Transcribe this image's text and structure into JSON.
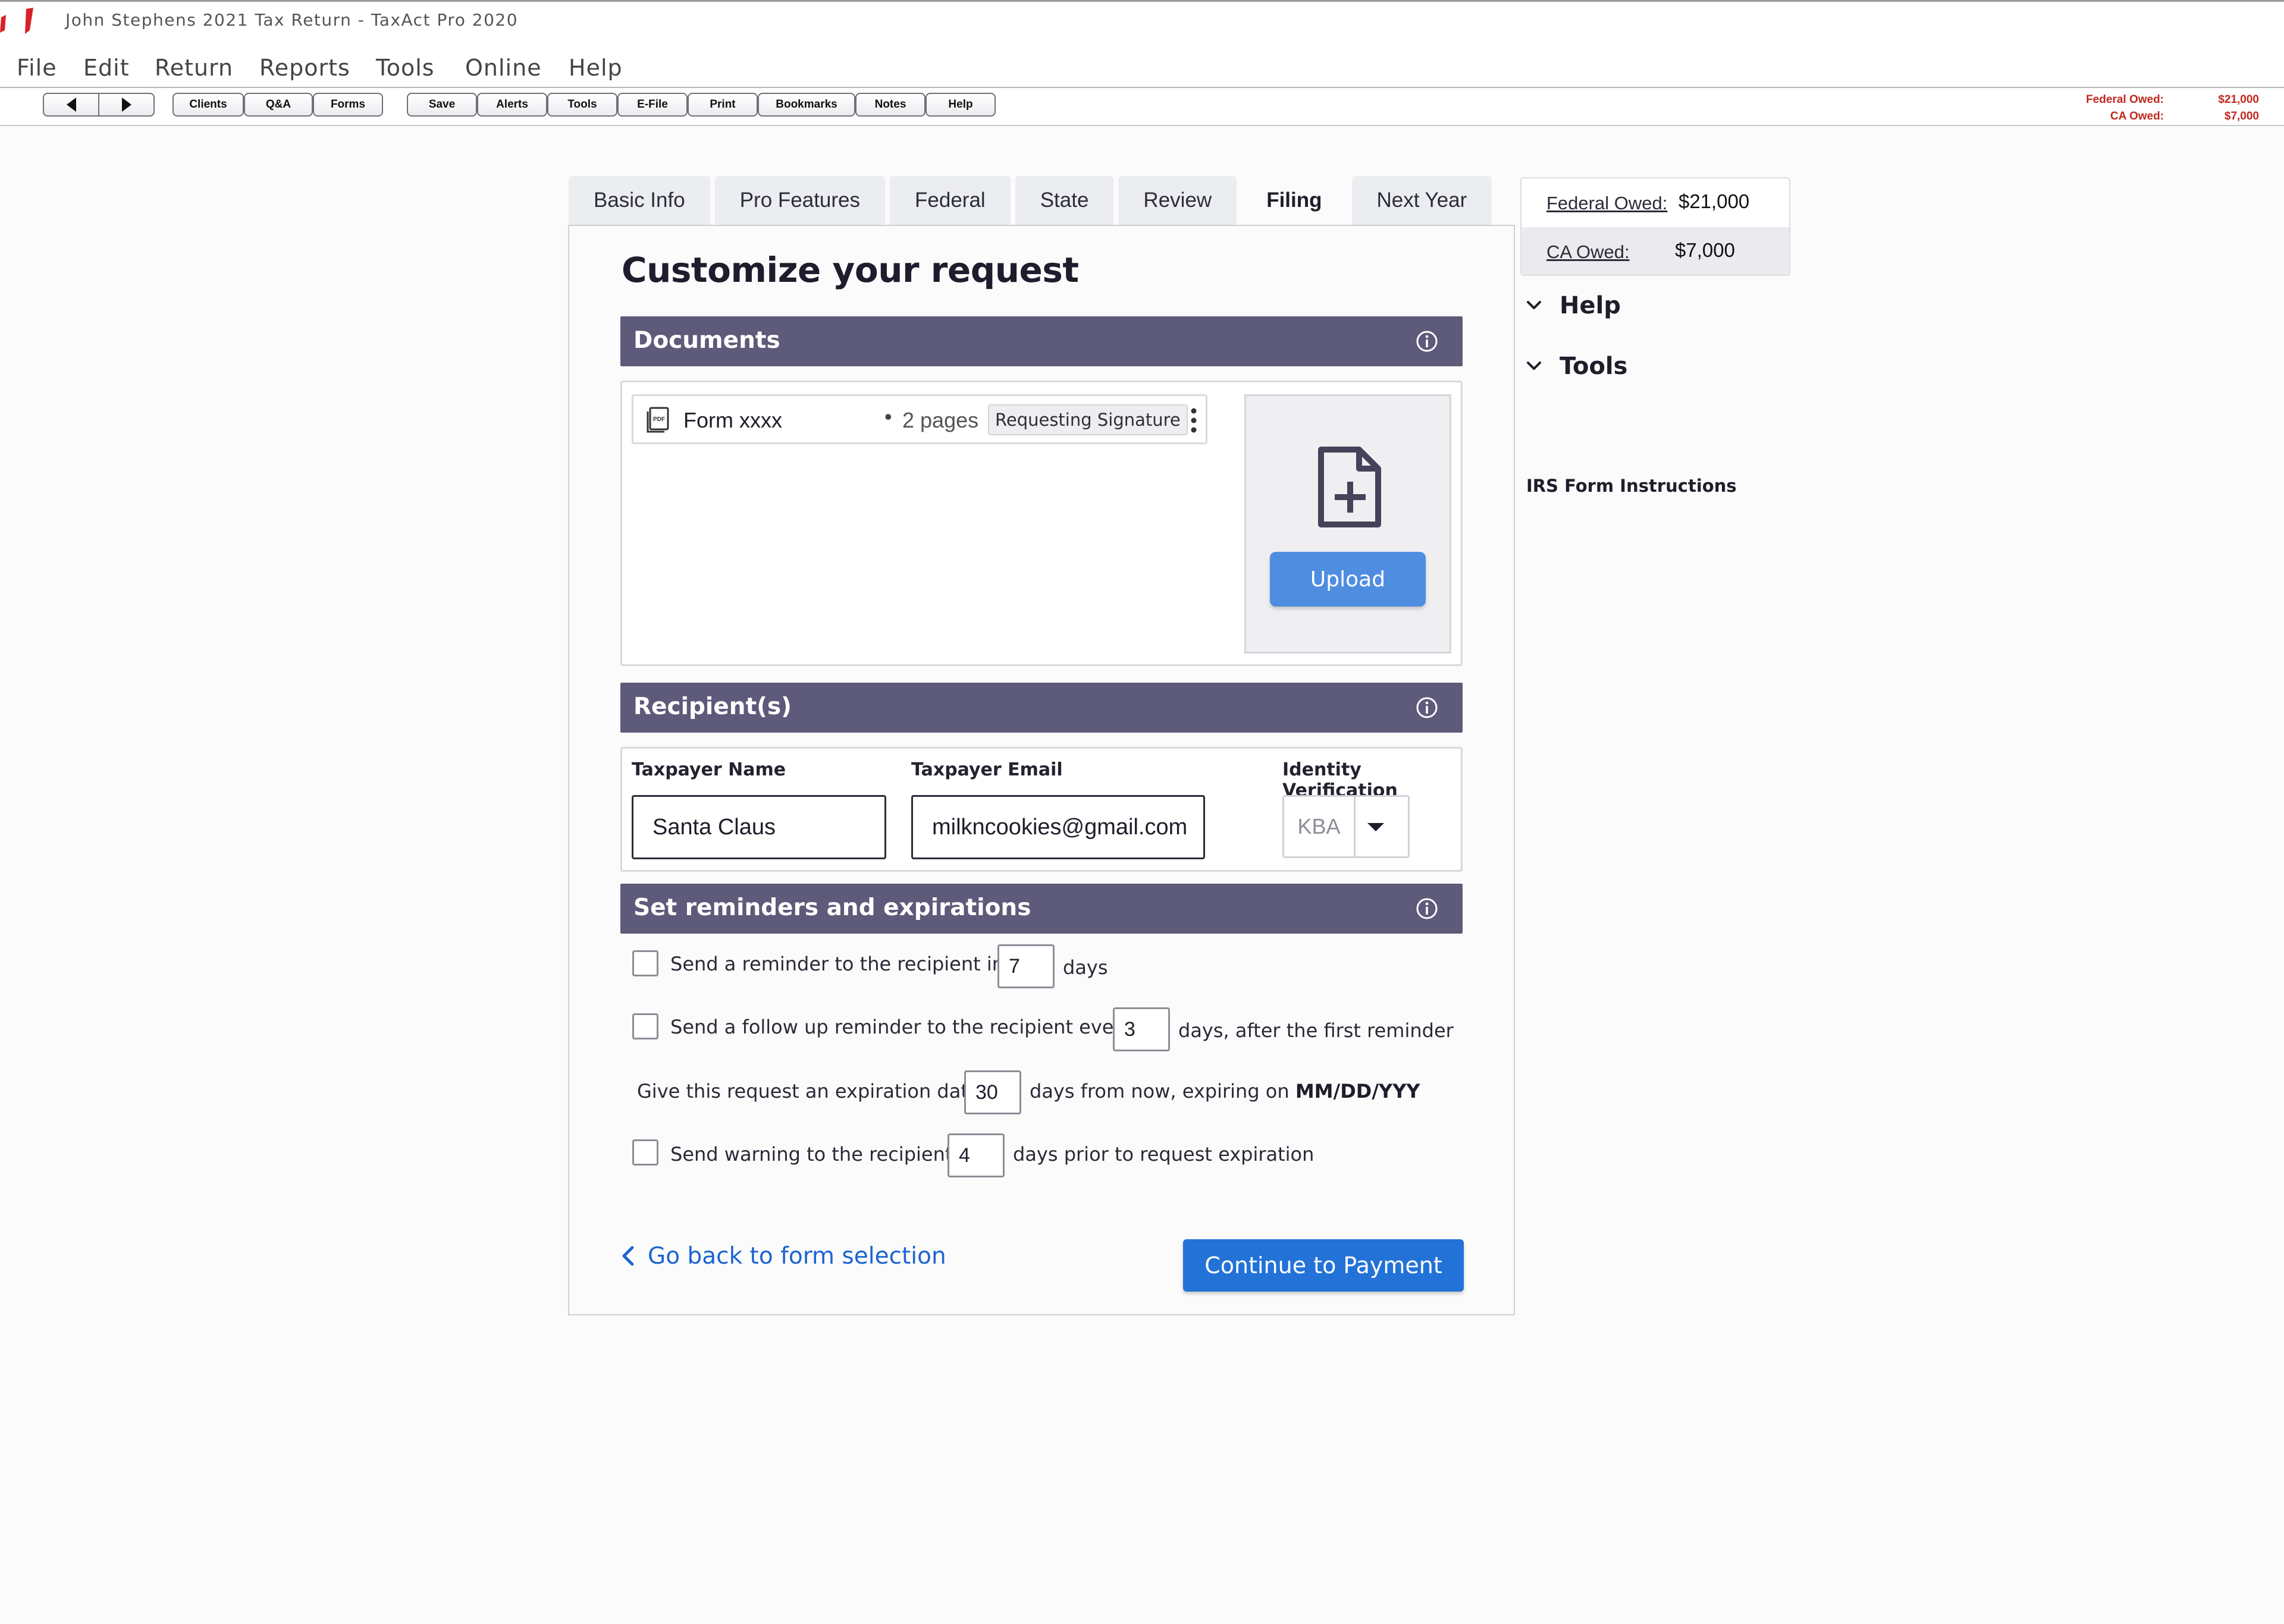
{
  "window": {
    "title": "John Stephens 2021 Tax Return - TaxAct Pro 2020"
  },
  "menu": [
    "File",
    "Edit",
    "Return",
    "Reports",
    "Tools",
    "Online",
    "Help"
  ],
  "toolbar": {
    "group1": [
      "Clients",
      "Q&A",
      "Forms"
    ],
    "group2": [
      "Save",
      "Alerts",
      "Tools",
      "E-File",
      "Print",
      "Bookmarks",
      "Notes",
      "Help"
    ],
    "federal_owed_label": "Federal Owed:",
    "federal_owed_value": "$21,000",
    "ca_owed_label": "CA Owed:",
    "ca_owed_value": "$7,000",
    "owed_color": "#c0281e"
  },
  "tabs": [
    {
      "label": "Basic Info",
      "active": false
    },
    {
      "label": "Pro Features",
      "active": false
    },
    {
      "label": "Federal",
      "active": false
    },
    {
      "label": "State",
      "active": false
    },
    {
      "label": "Review",
      "active": false
    },
    {
      "label": "Filing",
      "active": true
    },
    {
      "label": "Next Year",
      "active": false
    }
  ],
  "page": {
    "title": "Customize your request"
  },
  "documents": {
    "section_title": "Documents",
    "items": [
      {
        "name": "Form xxxx",
        "pages": "2 pages",
        "status": "Requesting Signature"
      }
    ],
    "upload_label": "Upload"
  },
  "recipients": {
    "section_title": "Recipient(s)",
    "name_label": "Taxpayer Name",
    "name_value": "Santa Claus",
    "email_label": "Taxpayer Email",
    "email_value": "milkncookies@gmail.com",
    "verification_label": "Identity Verification",
    "verification_value": "KBA"
  },
  "reminders": {
    "section_title": "Set reminders and expirations",
    "reminder": {
      "before": "Send a reminder to the recipient in",
      "value": "7",
      "after": "days",
      "checked": false
    },
    "followup": {
      "before": "Send a follow up reminder to the recipient every",
      "value": "3",
      "after": "days, after the first reminder",
      "checked": false
    },
    "expiration": {
      "before": "Give this request an expiration date",
      "value": "30",
      "after": "days from now, expiring on",
      "date": "MM/DD/YYY"
    },
    "warning": {
      "before": "Send warning to the recipient",
      "value": "4",
      "after": "days prior to request expiration",
      "checked": false
    }
  },
  "footer": {
    "back_label": "Go back to form selection",
    "continue_label": "Continue to Payment"
  },
  "sidebar": {
    "federal_owed_label": "Federal Owed:",
    "federal_owed_value": "$21,000",
    "ca_owed_label": "CA Owed:",
    "ca_owed_value": "$7,000",
    "help_label": "Help",
    "tools_label": "Tools",
    "irs_link": "IRS Form Instructions"
  },
  "colors": {
    "section_header": "#5e5a7a",
    "primary_button": "#2372d8",
    "upload_button": "#4f8de0",
    "link": "#1c64d0"
  }
}
